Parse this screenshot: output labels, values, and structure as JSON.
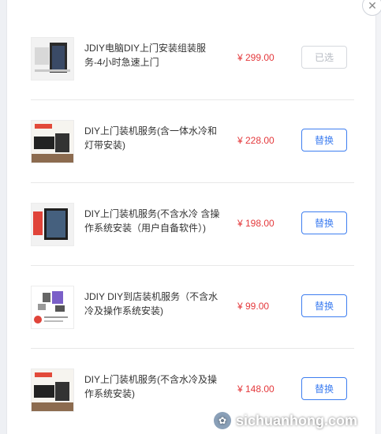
{
  "dialog": {
    "close_glyph": "✕",
    "items": [
      {
        "name": "JDIY电脑DIY上门安装组装服务-4小时急速上门",
        "price": "¥ 299.00",
        "action": "已选",
        "state": "selected"
      },
      {
        "name": "DIY上门装机服务(含一体水冷和灯带安装)",
        "price": "¥ 228.00",
        "action": "替换",
        "state": "replace"
      },
      {
        "name": "DIY上门装机服务(不含水冷 含操作系统安装（用户自备软件）)",
        "price": "¥ 198.00",
        "action": "替换",
        "state": "replace"
      },
      {
        "name": "JDIY DIY到店装机服务（不含水冷及操作系统安装)",
        "price": "¥ 99.00",
        "action": "替换",
        "state": "replace"
      },
      {
        "name": "DIY上门装机服务(不含水冷及操作系统安装)",
        "price": "¥ 148.00",
        "action": "替换",
        "state": "replace"
      }
    ]
  },
  "watermark": {
    "text": "sichuanhong.com"
  },
  "colors": {
    "price": "#e4393c",
    "accent": "#3e7ef0",
    "disabled": "#b6bac2"
  }
}
